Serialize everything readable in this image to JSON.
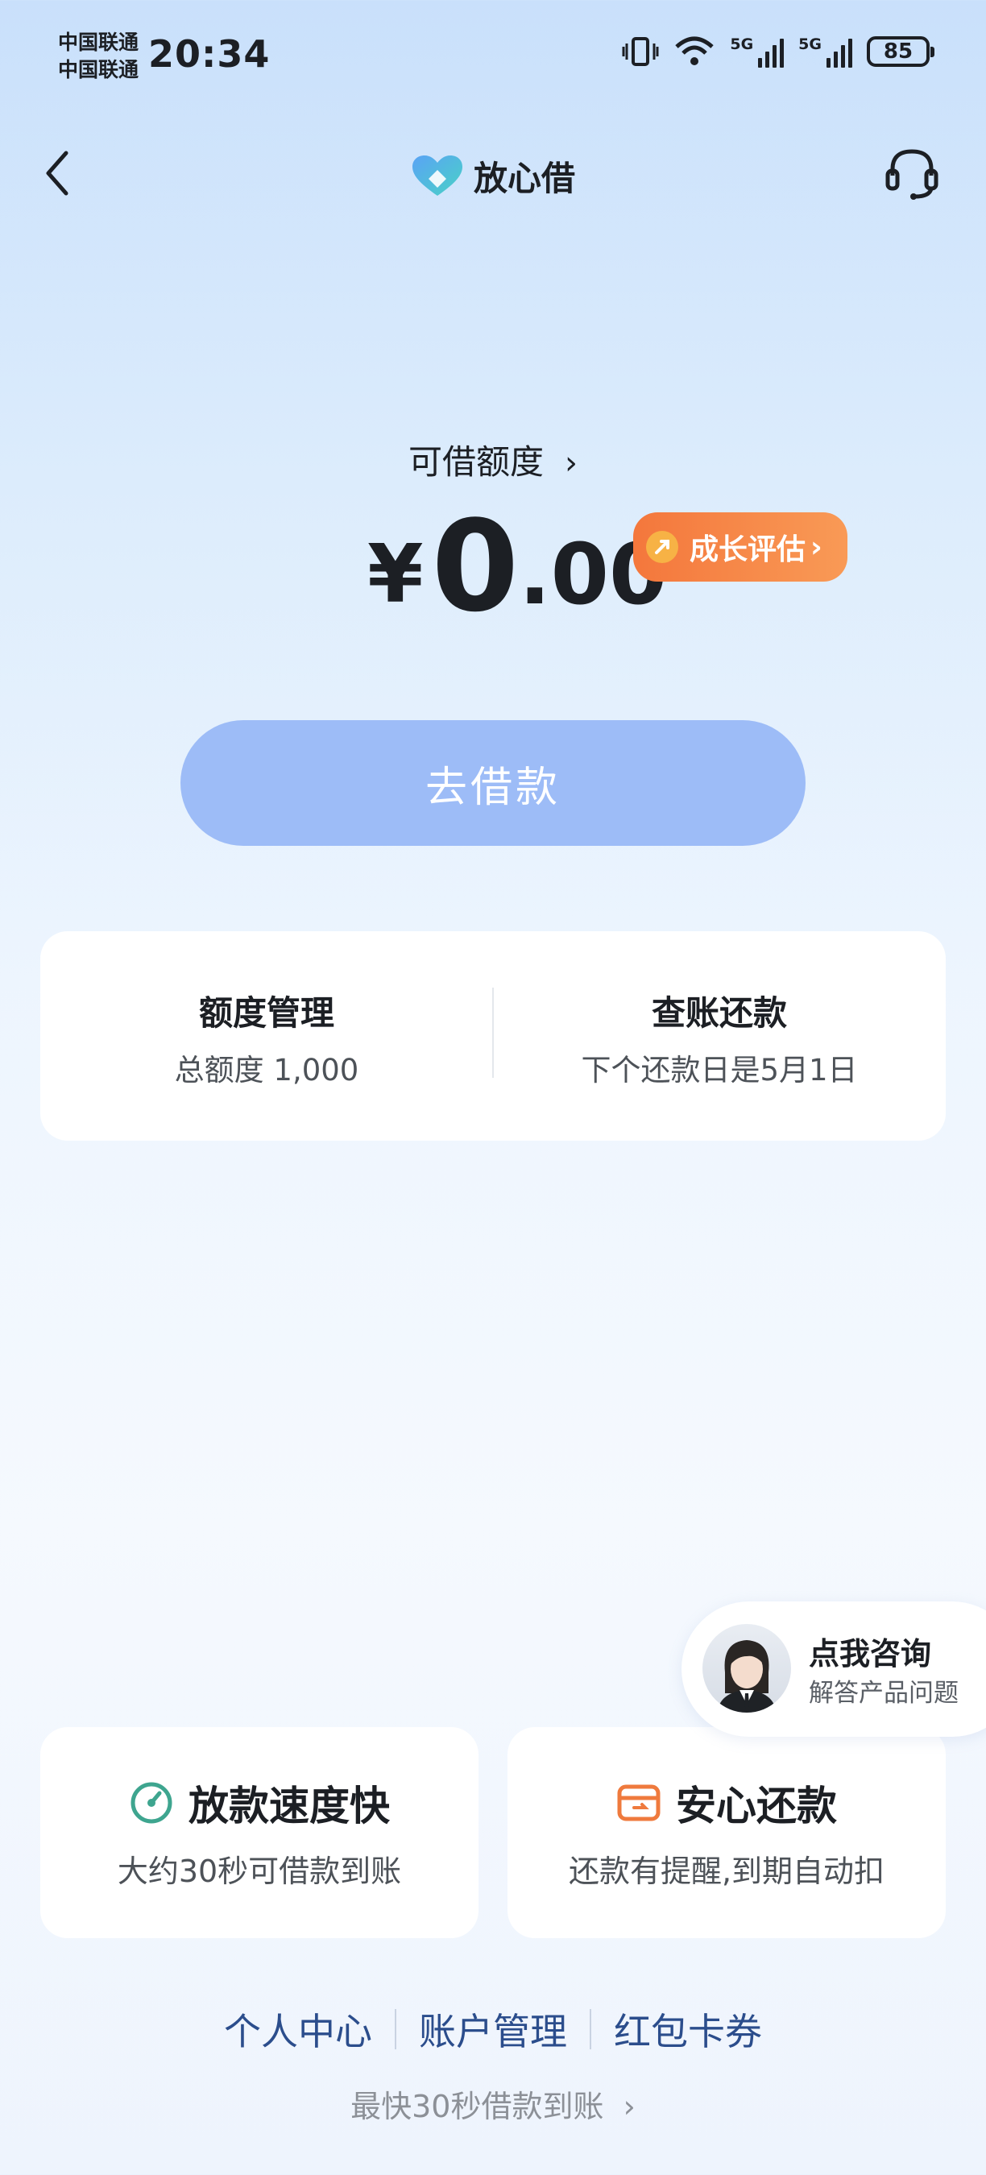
{
  "status_bar": {
    "carrier_1": "中国联通",
    "carrier_2": "中国联通",
    "time": "20:34",
    "network_1": "5G",
    "network_2": "5G",
    "battery": "85"
  },
  "header": {
    "app_name": "放心借",
    "back_icon": "chevron-left-icon",
    "service_icon": "headset-icon"
  },
  "credit": {
    "label": "可借额度",
    "currency": "¥",
    "amount_int": "0",
    "amount_dec": ".00",
    "growth_label": "成长评估"
  },
  "borrow_button": "去借款",
  "manage": {
    "limit_title": "额度管理",
    "limit_sub": "总额度 1,000",
    "repay_title": "查账还款",
    "repay_sub": "下个还款日是5月1日"
  },
  "consult": {
    "title": "点我咨询",
    "subtitle": "解答产品问题"
  },
  "features": [
    {
      "title": "放款速度快",
      "subtitle": "大约30秒可借款到账",
      "icon": "speedometer-icon"
    },
    {
      "title": "安心还款",
      "subtitle": "还款有提醒,到期自动扣",
      "icon": "wallet-icon"
    }
  ],
  "footer": {
    "links": [
      "个人中心",
      "账户管理",
      "红包卡券"
    ],
    "tagline": "最快30秒借款到账"
  },
  "colors": {
    "accent_blue": "#9dbcf7",
    "growth_orange": "#f4773c",
    "link_blue": "#2b4d8c"
  }
}
